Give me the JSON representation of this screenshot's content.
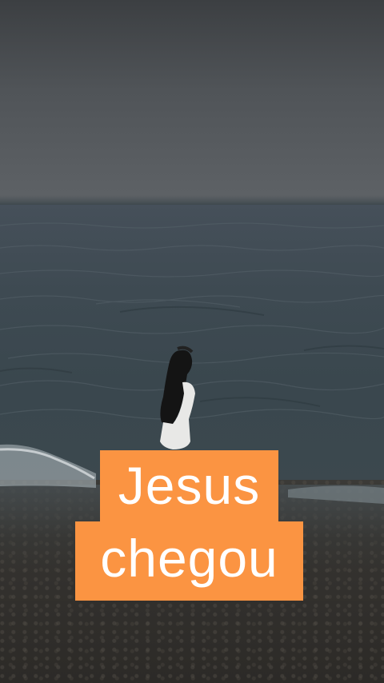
{
  "video": {
    "scene_description_hidden": "",
    "caption": {
      "line1": "Jesus",
      "line2": "chegou",
      "background_color": "#fb9442",
      "text_color": "#ffffff"
    },
    "colors": {
      "sky": "#505458",
      "sea": "#3e4a52",
      "sand": "#34322f"
    }
  }
}
